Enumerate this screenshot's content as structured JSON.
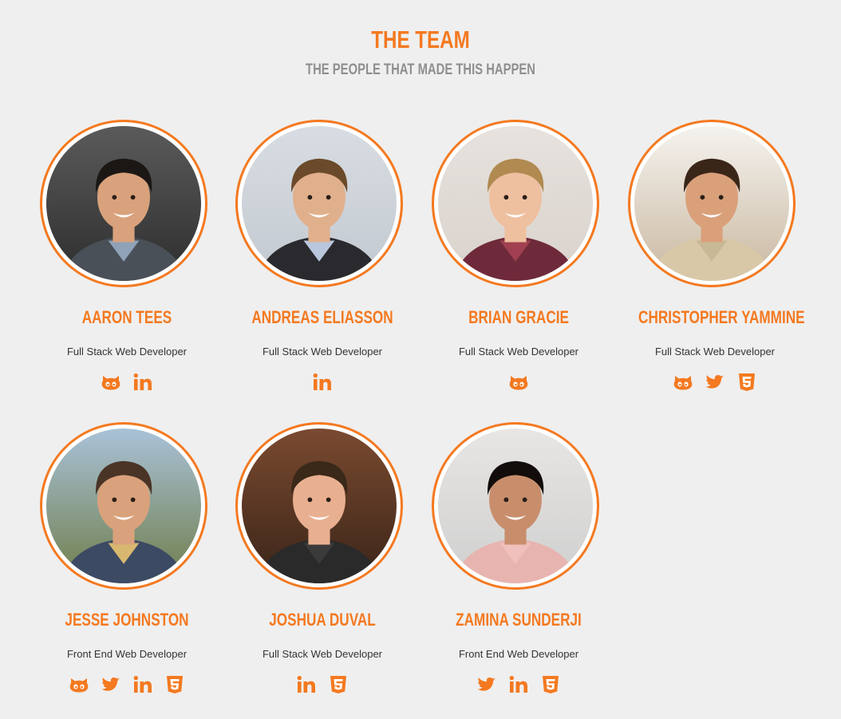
{
  "header": {
    "title": "THE TEAM",
    "subtitle": "THE PEOPLE THAT MADE THIS HAPPEN"
  },
  "colors": {
    "accent": "#f47920",
    "subtitle": "#8f8f8f",
    "background": "#efefef"
  },
  "members": [
    {
      "name": "AARON TEES",
      "role": "Full Stack Web Developer",
      "socials": [
        "github-icon",
        "linkedin-icon"
      ]
    },
    {
      "name": "ANDREAS ELIASSON",
      "role": "Full Stack Web Developer",
      "socials": [
        "linkedin-icon"
      ]
    },
    {
      "name": "BRIAN GRACIE",
      "role": "Full Stack Web Developer",
      "socials": [
        "github-icon"
      ]
    },
    {
      "name": "CHRISTOPHER YAMMINE",
      "role": "Full Stack Web Developer",
      "socials": [
        "github-icon",
        "twitter-icon",
        "html5-icon"
      ]
    },
    {
      "name": "JESSE JOHNSTON",
      "role": "Front End Web Developer",
      "socials": [
        "github-icon",
        "twitter-icon",
        "linkedin-icon",
        "html5-icon"
      ]
    },
    {
      "name": "JOSHUA DUVAL",
      "role": "Full Stack Web Developer",
      "socials": [
        "linkedin-icon",
        "html5-icon"
      ]
    },
    {
      "name": "ZAMINA SUNDERJI",
      "role": "Front End Web Developer",
      "socials": [
        "twitter-icon",
        "linkedin-icon",
        "html5-icon"
      ]
    }
  ]
}
